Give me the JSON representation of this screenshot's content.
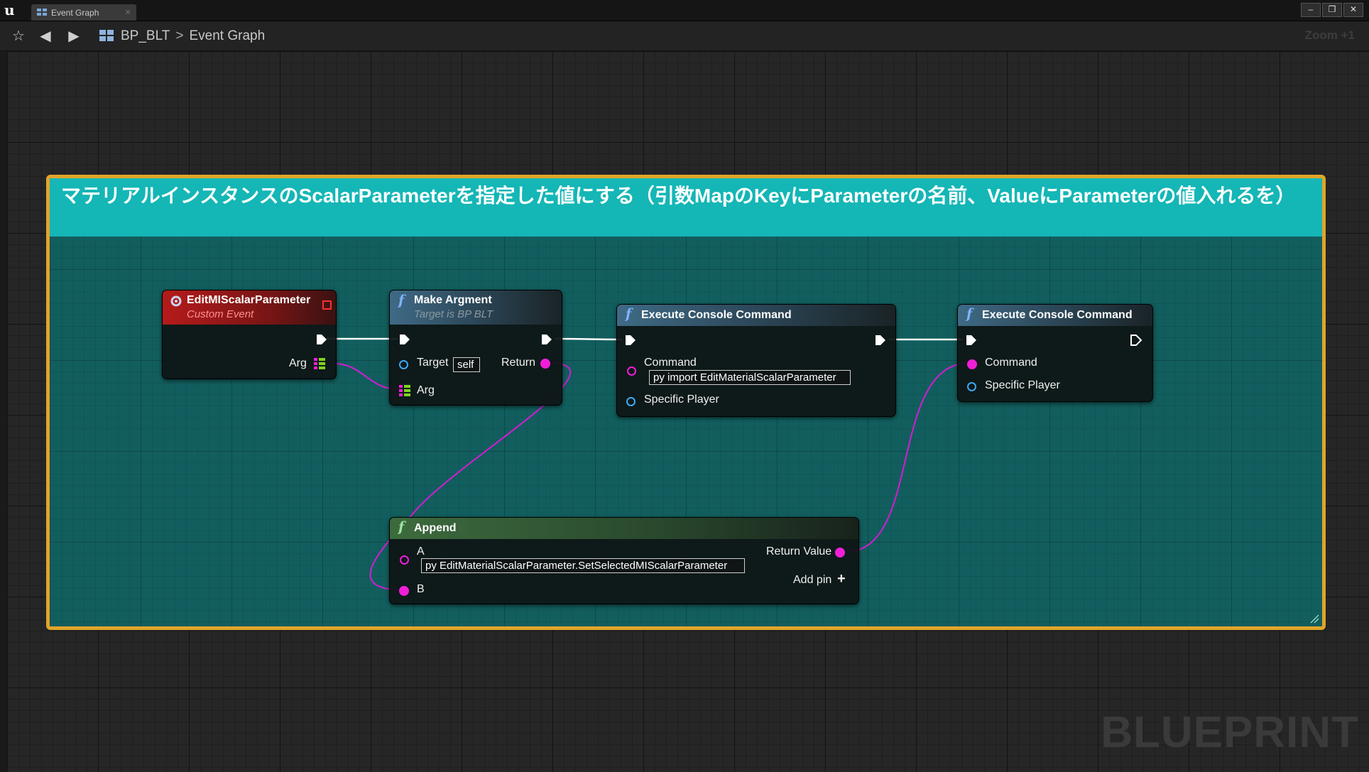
{
  "window": {
    "tab_label": "Event Graph",
    "tab_close": "×",
    "minimize": "–",
    "restore": "❐",
    "close": "✕"
  },
  "toolbar": {
    "breadcrumb_blueprint": "BP_BLT",
    "breadcrumb_separator": ">",
    "breadcrumb_graph": "Event Graph",
    "zoom": "Zoom +1"
  },
  "comment": {
    "text": "マテリアルインスタンスのScalarParameterを指定した値にする（引数MapのKeyにParameterの名前、ValueにParameterの値入れるを）",
    "color": "#15b6b6",
    "border_color": "#e0a529"
  },
  "nodes": {
    "custom_event": {
      "title": "EditMIScalarParameter",
      "subtitle": "Custom Event",
      "arg_pin": "Arg"
    },
    "make_argment": {
      "title": "Make Argment",
      "subtitle": "Target is BP BLT",
      "target_pin": "Target",
      "target_value": "self",
      "return_pin": "Return",
      "arg_pin": "Arg"
    },
    "exec_console_1": {
      "title": "Execute Console Command",
      "command_pin": "Command",
      "command_value": "py import EditMaterialScalarParameter",
      "player_pin": "Specific Player"
    },
    "exec_console_2": {
      "title": "Execute Console Command",
      "command_pin": "Command",
      "player_pin": "Specific Player"
    },
    "append": {
      "title": "Append",
      "a_pin": "A",
      "a_value": "py EditMaterialScalarParameter.SetSelectedMIScalarParameter",
      "b_pin": "B",
      "return_pin": "Return Value",
      "add_pin": "Add pin"
    }
  },
  "colors": {
    "exec_wire": "#ffffff",
    "string_wire": "#d21dd2",
    "string_pin": "#f01ed8",
    "object_pin": "#3ba9f5",
    "map_pin": "#7ed321"
  },
  "watermark": "BLUEPRINT"
}
